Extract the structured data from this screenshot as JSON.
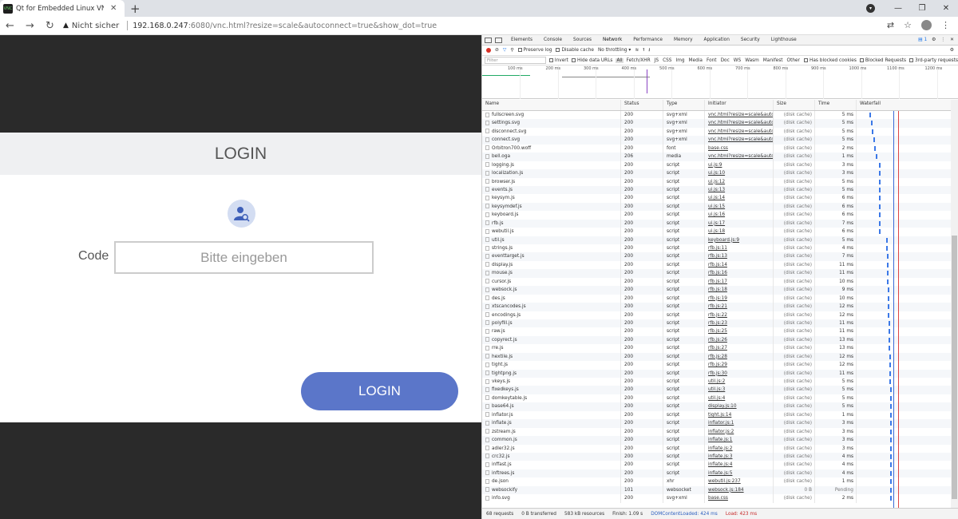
{
  "browser": {
    "tab_title": "Qt for Embedded Linux VNC Serv",
    "favicon_text": "VNC",
    "new_tab": "+",
    "insecure_label": "Nicht sicher",
    "url_host": "192.168.0.247",
    "url_rest": ":6080/vnc.html?resize=scale&autoconnect=true&show_dot=true"
  },
  "page": {
    "header_title": "LOGIN",
    "code_label": "Code",
    "code_placeholder": "Bitte eingeben",
    "login_button": "LOGIN"
  },
  "devtools": {
    "tabs": [
      "Elements",
      "Console",
      "Sources",
      "Network",
      "Performance",
      "Memory",
      "Application",
      "Security",
      "Lighthouse"
    ],
    "active_tab": "Network",
    "issues_badge": "1",
    "preserve_log": "Preserve log",
    "disable_cache": "Disable cache",
    "throttling": "No throttling",
    "filter_placeholder": "Filter",
    "invert": "Invert",
    "hide_data_urls": "Hide data URLs",
    "type_filters": [
      "All",
      "Fetch/XHR",
      "JS",
      "CSS",
      "Img",
      "Media",
      "Font",
      "Doc",
      "WS",
      "Wasm",
      "Manifest",
      "Other"
    ],
    "has_blocked_cookies": "Has blocked cookies",
    "blocked_requests": "Blocked Requests",
    "third_party": "3rd-party requests",
    "timeline_ticks": [
      "100 ms",
      "200 ms",
      "300 ms",
      "400 ms",
      "500 ms",
      "600 ms",
      "700 ms",
      "800 ms",
      "900 ms",
      "1000 ms",
      "1100 ms",
      "1200 ms"
    ],
    "columns": [
      "Name",
      "Status",
      "Type",
      "Initiator",
      "Size",
      "Time",
      "Waterfall"
    ],
    "rows": [
      [
        "fullscreen.svg",
        "200",
        "svg+xml",
        "vnc.html?resize=scale&autoc...",
        "(disk cache)",
        "5 ms"
      ],
      [
        "settings.svg",
        "200",
        "svg+xml",
        "vnc.html?resize=scale&autoc...",
        "(disk cache)",
        "5 ms"
      ],
      [
        "disconnect.svg",
        "200",
        "svg+xml",
        "vnc.html?resize=scale&autoc...",
        "(disk cache)",
        "5 ms"
      ],
      [
        "connect.svg",
        "200",
        "svg+xml",
        "vnc.html?resize=scale&autoc...",
        "(disk cache)",
        "5 ms"
      ],
      [
        "Orbitron700.woff",
        "200",
        "font",
        "base.css",
        "(disk cache)",
        "2 ms"
      ],
      [
        "bell.oga",
        "206",
        "media",
        "vnc.html?resize=scale&autoc...",
        "(disk cache)",
        "1 ms"
      ],
      [
        "logging.js",
        "200",
        "script",
        "ui.js:9",
        "(disk cache)",
        "3 ms"
      ],
      [
        "localization.js",
        "200",
        "script",
        "ui.js:10",
        "(disk cache)",
        "3 ms"
      ],
      [
        "browser.js",
        "200",
        "script",
        "ui.js:12",
        "(disk cache)",
        "5 ms"
      ],
      [
        "events.js",
        "200",
        "script",
        "ui.js:13",
        "(disk cache)",
        "5 ms"
      ],
      [
        "keysym.js",
        "200",
        "script",
        "ui.js:14",
        "(disk cache)",
        "6 ms"
      ],
      [
        "keysymdef.js",
        "200",
        "script",
        "ui.js:15",
        "(disk cache)",
        "6 ms"
      ],
      [
        "keyboard.js",
        "200",
        "script",
        "ui.js:16",
        "(disk cache)",
        "6 ms"
      ],
      [
        "rfb.js",
        "200",
        "script",
        "ui.js:17",
        "(disk cache)",
        "7 ms"
      ],
      [
        "webutil.js",
        "200",
        "script",
        "ui.js:18",
        "(disk cache)",
        "6 ms"
      ],
      [
        "util.js",
        "200",
        "script",
        "keyboard.js:9",
        "(disk cache)",
        "5 ms"
      ],
      [
        "strings.js",
        "200",
        "script",
        "rfb.js:11",
        "(disk cache)",
        "4 ms"
      ],
      [
        "eventtarget.js",
        "200",
        "script",
        "rfb.js:13",
        "(disk cache)",
        "7 ms"
      ],
      [
        "display.js",
        "200",
        "script",
        "rfb.js:14",
        "(disk cache)",
        "11 ms"
      ],
      [
        "mouse.js",
        "200",
        "script",
        "rfb.js:16",
        "(disk cache)",
        "11 ms"
      ],
      [
        "cursor.js",
        "200",
        "script",
        "rfb.js:17",
        "(disk cache)",
        "10 ms"
      ],
      [
        "websock.js",
        "200",
        "script",
        "rfb.js:18",
        "(disk cache)",
        "9 ms"
      ],
      [
        "des.js",
        "200",
        "script",
        "rfb.js:19",
        "(disk cache)",
        "10 ms"
      ],
      [
        "xtscancodes.js",
        "200",
        "script",
        "rfb.js:21",
        "(disk cache)",
        "12 ms"
      ],
      [
        "encodings.js",
        "200",
        "script",
        "rfb.js:22",
        "(disk cache)",
        "12 ms"
      ],
      [
        "polyfill.js",
        "200",
        "script",
        "rfb.js:23",
        "(disk cache)",
        "11 ms"
      ],
      [
        "raw.js",
        "200",
        "script",
        "rfb.js:25",
        "(disk cache)",
        "11 ms"
      ],
      [
        "copyrect.js",
        "200",
        "script",
        "rfb.js:26",
        "(disk cache)",
        "13 ms"
      ],
      [
        "rre.js",
        "200",
        "script",
        "rfb.js:27",
        "(disk cache)",
        "13 ms"
      ],
      [
        "hextile.js",
        "200",
        "script",
        "rfb.js:28",
        "(disk cache)",
        "12 ms"
      ],
      [
        "tight.js",
        "200",
        "script",
        "rfb.js:29",
        "(disk cache)",
        "12 ms"
      ],
      [
        "tightpng.js",
        "200",
        "script",
        "rfb.js:30",
        "(disk cache)",
        "11 ms"
      ],
      [
        "vkeys.js",
        "200",
        "script",
        "util.js:2",
        "(disk cache)",
        "5 ms"
      ],
      [
        "fixedkeys.js",
        "200",
        "script",
        "util.js:3",
        "(disk cache)",
        "5 ms"
      ],
      [
        "domkeytable.js",
        "200",
        "script",
        "util.js:4",
        "(disk cache)",
        "5 ms"
      ],
      [
        "base64.js",
        "200",
        "script",
        "display.js:10",
        "(disk cache)",
        "5 ms"
      ],
      [
        "inflator.js",
        "200",
        "script",
        "tight.js:14",
        "(disk cache)",
        "1 ms"
      ],
      [
        "inflate.js",
        "200",
        "script",
        "inflator.js:1",
        "(disk cache)",
        "3 ms"
      ],
      [
        "zstream.js",
        "200",
        "script",
        "inflator.js:2",
        "(disk cache)",
        "3 ms"
      ],
      [
        "common.js",
        "200",
        "script",
        "inflate.js:1",
        "(disk cache)",
        "3 ms"
      ],
      [
        "adler32.js",
        "200",
        "script",
        "inflate.js:2",
        "(disk cache)",
        "3 ms"
      ],
      [
        "crc32.js",
        "200",
        "script",
        "inflate.js:3",
        "(disk cache)",
        "4 ms"
      ],
      [
        "inffast.js",
        "200",
        "script",
        "inflate.js:4",
        "(disk cache)",
        "4 ms"
      ],
      [
        "inftrees.js",
        "200",
        "script",
        "inflate.js:5",
        "(disk cache)",
        "4 ms"
      ],
      [
        "de.json",
        "200",
        "xhr",
        "webutil.js:237",
        "(disk cache)",
        "1 ms"
      ],
      [
        "websockify",
        "101",
        "websocket",
        "websock.js:184",
        "0 B",
        "Pending"
      ],
      [
        "info.svg",
        "200",
        "svg+xml",
        "base.css",
        "(disk cache)",
        "2 ms"
      ]
    ],
    "status": {
      "requests": "68 requests",
      "transferred": "0 B transferred",
      "resources": "583 kB resources",
      "finish": "Finish: 1.09 s",
      "dcl": "DOMContentLoaded: 424 ms",
      "load": "Load: 423 ms"
    }
  }
}
